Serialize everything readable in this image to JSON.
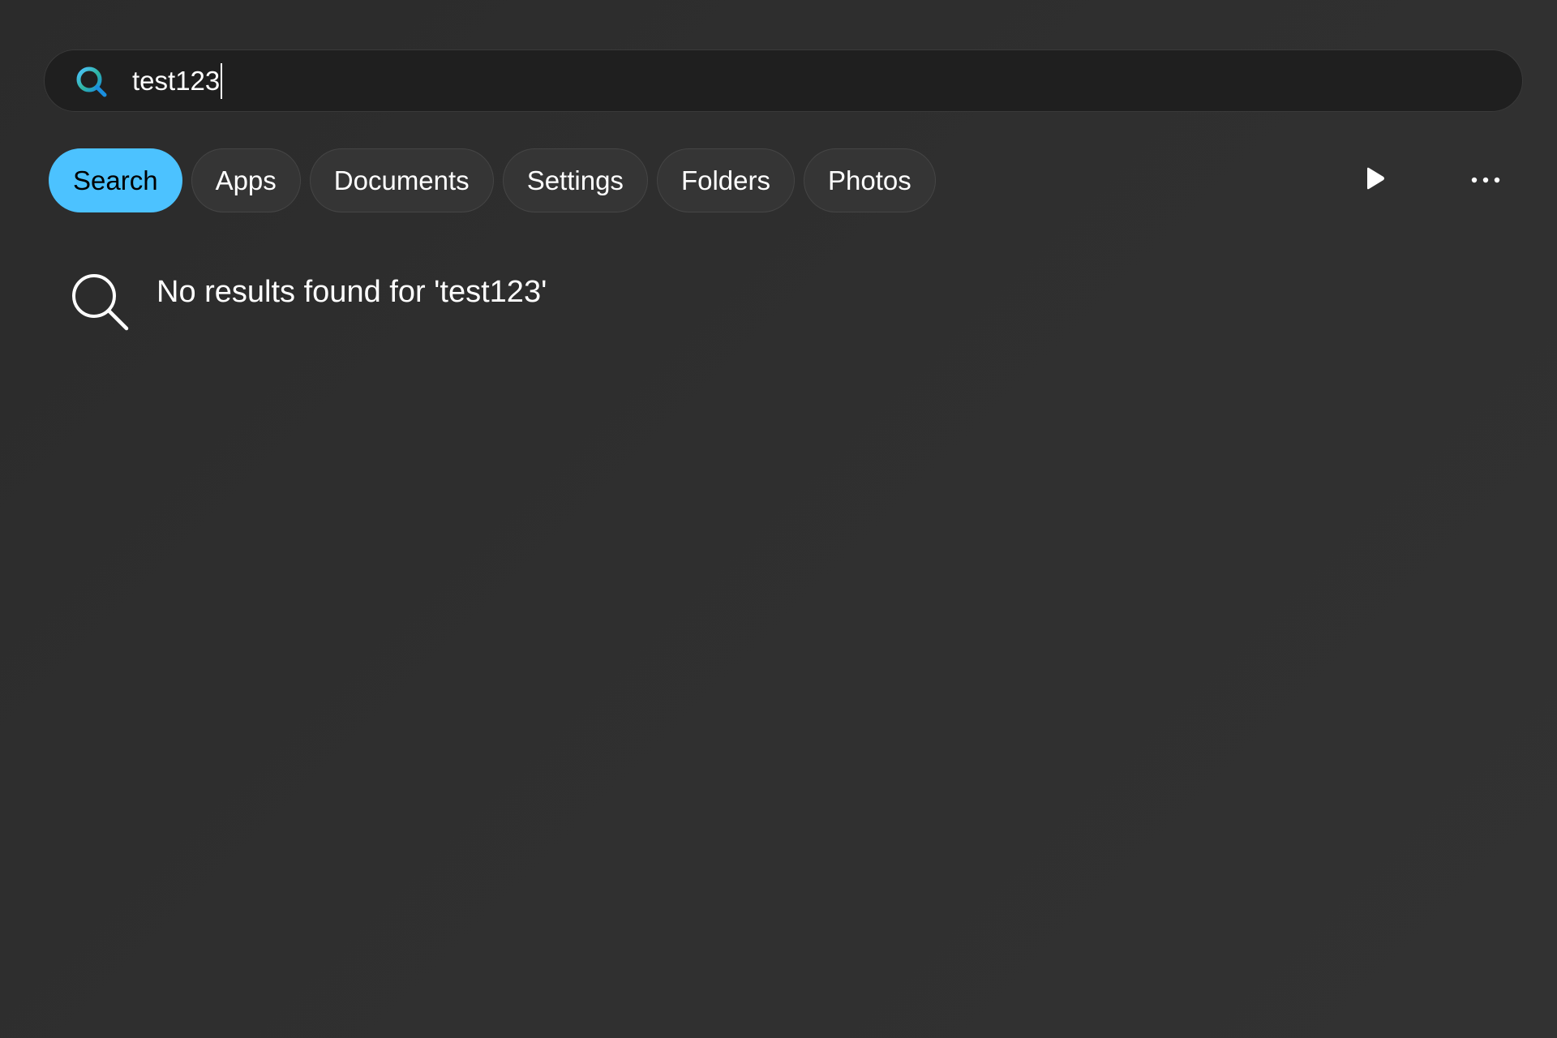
{
  "search": {
    "query": "test123",
    "icon": "search-icon-colored"
  },
  "filters": [
    {
      "label": "Search",
      "active": true
    },
    {
      "label": "Apps",
      "active": false
    },
    {
      "label": "Documents",
      "active": false
    },
    {
      "label": "Settings",
      "active": false
    },
    {
      "label": "Folders",
      "active": false
    },
    {
      "label": "Photos",
      "active": false
    }
  ],
  "controls": {
    "play_icon": "play-icon",
    "more_icon": "more-options-icon"
  },
  "results": {
    "message": "No results found for 'test123'",
    "icon": "search-icon"
  },
  "colors": {
    "accent": "#4cc2ff",
    "background": "#2e2e2e",
    "search_bar": "#1f1f1f",
    "pill": "#353535"
  }
}
